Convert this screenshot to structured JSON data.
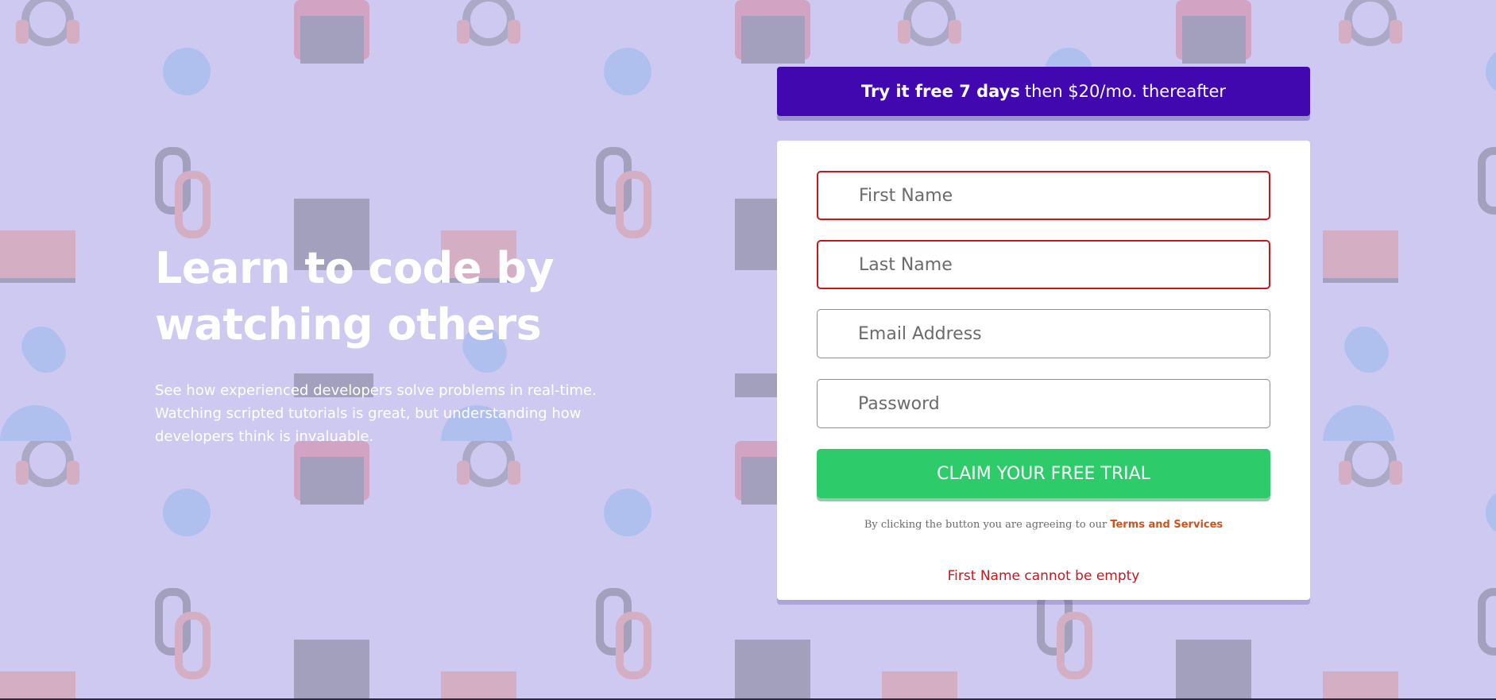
{
  "hero": {
    "title": "Learn to code by watching others",
    "text": "See how experienced developers solve problems in real-time. Watching scripted tutorials is great, but understanding how developers think is invaluable."
  },
  "promo": {
    "bold": "Try it free 7 days",
    "rest": "then $20/mo. thereafter"
  },
  "form": {
    "first_name_placeholder": "First Name",
    "last_name_placeholder": "Last Name",
    "email_placeholder": "Email Address",
    "password_placeholder": "Password",
    "submit_label": "CLAIM YOUR FREE TRIAL",
    "terms_prefix": "By clicking the button you are agreeing to our",
    "terms_link": "Terms and Services",
    "error_message": "First Name cannot be empty"
  },
  "colors": {
    "background": "#cdc9f1",
    "banner": "#4208b0",
    "button": "#2ecb6b",
    "error": "#c8161d",
    "link": "#d0531e"
  },
  "icons": [
    "headset-icon",
    "toolbox-icon",
    "chain-link-icon",
    "bar-chart-icon",
    "rocket-icon",
    "globe-icon",
    "lifebuoy-icon",
    "calendar-icon",
    "lightbulb-icon",
    "browser-window-icon"
  ]
}
